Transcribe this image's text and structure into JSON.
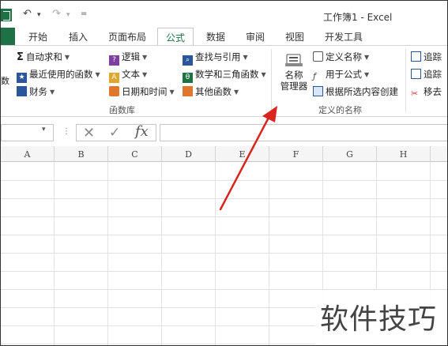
{
  "window": {
    "title": "工作簿1 - Excel"
  },
  "quick_access": {
    "undo_icon": "↶",
    "redo_icon": "↷",
    "dropdown": "▾",
    "customize": "="
  },
  "tabs": [
    {
      "label": "开始"
    },
    {
      "label": "插入"
    },
    {
      "label": "页面布局"
    },
    {
      "label": "公式",
      "active": true
    },
    {
      "label": "数据"
    },
    {
      "label": "审阅"
    },
    {
      "label": "视图"
    },
    {
      "label": "开发工具"
    }
  ],
  "ribbon": {
    "function_library": {
      "label": "函数库",
      "edge_text": "数",
      "autosum": "自动求和",
      "autosum_icon": "Σ",
      "recent": "最近使用的函数",
      "financial": "财务",
      "logical": "逻辑",
      "text": "文本",
      "datetime": "日期和时间",
      "lookup": "查找与引用",
      "math": "数学和三角函数",
      "more": "其他函数"
    },
    "defined_names": {
      "label": "定义的名称",
      "name_manager_line1": "名称",
      "name_manager_line2": "管理器",
      "define_name": "定义名称",
      "use_in_formula": "用于公式",
      "create_from_selection": "根据所选内容创建"
    },
    "formula_auditing": {
      "trace_precedents": "追踪",
      "trace_dependents": "追踪",
      "remove_arrows": "移去"
    },
    "colors": {
      "excel_green": "#1e7145",
      "blue_icon": "#2b579a",
      "purple_icon": "#7e3fa0",
      "orange_icon": "#e0772f"
    }
  },
  "formula_bar": {
    "cancel_icon": "✕",
    "enter_icon": "✓",
    "fx_label": "fx",
    "dots": "⋮",
    "dropdown": "▾"
  },
  "grid": {
    "columns": [
      "A",
      "B",
      "C",
      "D",
      "E",
      "F",
      "G",
      "H"
    ]
  },
  "annotation": {
    "arrow_color": "#d9251d"
  },
  "watermark": {
    "text": "软件技巧"
  }
}
